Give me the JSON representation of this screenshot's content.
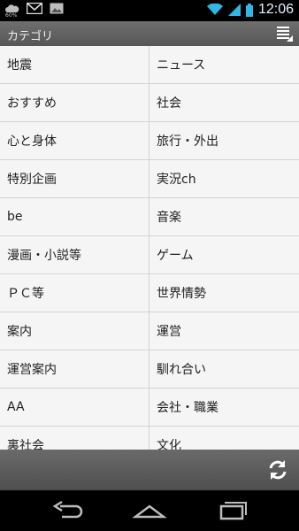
{
  "status": {
    "battery_small": "60%",
    "time": "12:06",
    "icons": [
      "cloud-icon",
      "gmail-icon",
      "image-icon",
      "wifi-icon",
      "signal-icon",
      "battery-icon"
    ]
  },
  "actionbar": {
    "title": "カテゴリ",
    "menu_icon": "overflow-menu-icon"
  },
  "categories": [
    [
      "地震",
      "ニュース"
    ],
    [
      "おすすめ",
      "社会"
    ],
    [
      "心と身体",
      "旅行・外出"
    ],
    [
      "特別企画",
      "実況ch"
    ],
    [
      "be",
      "音楽"
    ],
    [
      "漫画・小説等",
      "ゲーム"
    ],
    [
      "ＰＣ等",
      "世界情勢"
    ],
    [
      "案内",
      "運営"
    ],
    [
      "運営案内",
      "馴れ合い"
    ],
    [
      "AA",
      "会社・職業"
    ],
    [
      "裏社会",
      "文化"
    ]
  ],
  "bottom": {
    "refresh_icon": "refresh-icon"
  },
  "nav": {
    "icons": [
      "back-icon",
      "home-icon",
      "recent-apps-icon"
    ]
  }
}
